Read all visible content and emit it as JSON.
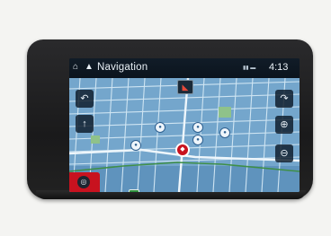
{
  "status_bar": {
    "home_icon": "home-icon",
    "nav_icon": "navigation-icon",
    "title": "Navigation",
    "signal_icon": "signal-icon",
    "clock": "4:13"
  },
  "map": {
    "water_color": "#74a6cc",
    "street_color": "#d9ecf7",
    "park_color": "#8fc28a",
    "route_color": "#3f8f47",
    "district_label": "",
    "highway_shield": ""
  },
  "controls": {
    "left": [
      {
        "name": "rotate-left-button",
        "icon": "rotate-left-icon",
        "glyph": "↶"
      },
      {
        "name": "direction-up-button",
        "icon": "arrow-up-icon",
        "glyph": "↑"
      }
    ],
    "right": [
      {
        "name": "rotate-right-button",
        "icon": "rotate-right-icon",
        "glyph": "↷"
      },
      {
        "name": "zoom-in-button",
        "icon": "zoom-in-icon",
        "glyph": "⊕"
      },
      {
        "name": "zoom-out-button",
        "icon": "zoom-out-icon",
        "glyph": "⊖"
      }
    ],
    "compass_icon": "compass-icon",
    "compass_glyph": "◣",
    "bottom_left_icon": "map-mode-icon",
    "bottom_left_glyph": "◎",
    "car_icon": "car-position-icon",
    "accent": "#c8121f"
  },
  "pins": [
    "poi-icon",
    "poi-icon",
    "poi-icon",
    "poi-icon",
    "poi-icon"
  ]
}
